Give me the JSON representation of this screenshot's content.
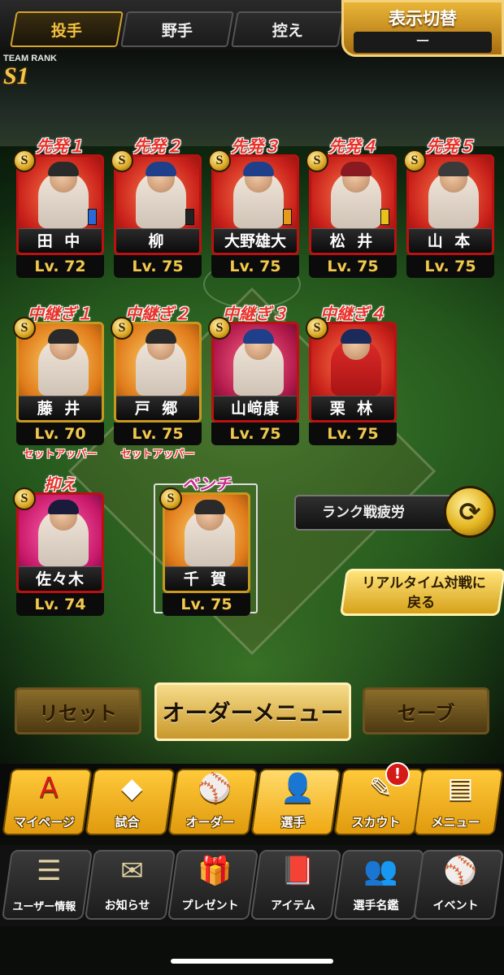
{
  "tabs": [
    {
      "label": "投手",
      "active": true
    },
    {
      "label": "野手",
      "active": false
    },
    {
      "label": "控え",
      "active": false
    }
  ],
  "display_toggle": {
    "label": "表示切替",
    "value": "ー"
  },
  "team_rank": {
    "label": "TEAM RANK",
    "value": "S1"
  },
  "starters": [
    {
      "role": "先発１",
      "name": "田 中",
      "level": "Lv. 72",
      "badge": "S"
    },
    {
      "role": "先発２",
      "name": "柳",
      "level": "Lv. 75",
      "badge": "S"
    },
    {
      "role": "先発３",
      "name": "大野雄大",
      "level": "Lv. 75",
      "badge": "S"
    },
    {
      "role": "先発４",
      "name": "松 井",
      "level": "Lv. 75",
      "badge": "S"
    },
    {
      "role": "先発５",
      "name": "山 本",
      "level": "Lv. 75",
      "badge": "S"
    }
  ],
  "relievers": [
    {
      "role": "中継ぎ１",
      "name": "藤 井",
      "level": "Lv. 70",
      "sub": "セットアッパー",
      "badge": "S"
    },
    {
      "role": "中継ぎ２",
      "name": "戸 郷",
      "level": "Lv. 75",
      "sub": "セットアッパー",
      "badge": "S"
    },
    {
      "role": "中継ぎ３",
      "name": "山﨑康",
      "level": "Lv. 75",
      "sub": "",
      "badge": "S"
    },
    {
      "role": "中継ぎ４",
      "name": "栗 林",
      "level": "Lv. 75",
      "sub": "",
      "badge": "S"
    }
  ],
  "closer": {
    "role": "抑え",
    "name": "佐々木",
    "level": "Lv. 74",
    "badge": "S"
  },
  "bench": {
    "role": "ベンチ",
    "name": "千 賀",
    "level": "Lv. 75",
    "badge": "S"
  },
  "rank_fatigue": {
    "label": "ランク戦疲労"
  },
  "realtime_back": {
    "line1": "リアルタイム対戦に",
    "line2": "戻る"
  },
  "order_buttons": {
    "reset": "リセット",
    "menu": "オーダーメニュー",
    "save": "セーブ"
  },
  "nav_primary": [
    {
      "label": "マイページ",
      "icon": "A"
    },
    {
      "label": "試合",
      "icon": "◆"
    },
    {
      "label": "オーダー",
      "icon": "⚾"
    },
    {
      "label": "選手",
      "icon": "👤"
    },
    {
      "label": "スカウト",
      "icon": "✎"
    },
    {
      "label": "メニュー",
      "icon": "▤"
    }
  ],
  "scout_badge": "!",
  "nav_secondary": [
    {
      "label": "ユーザー情報",
      "icon": "☰"
    },
    {
      "label": "お知らせ",
      "icon": "✉"
    },
    {
      "label": "プレゼント",
      "icon": "🎁"
    },
    {
      "label": "アイテム",
      "icon": "📕"
    },
    {
      "label": "選手名鑑",
      "icon": "👥"
    },
    {
      "label": "イベント",
      "icon": "⚾"
    }
  ],
  "colors": {
    "accent_gold": "#e2b21d",
    "role_red": "#e8322a",
    "bench_pink": "#c8278a",
    "level_gold": "#f2c94c"
  }
}
